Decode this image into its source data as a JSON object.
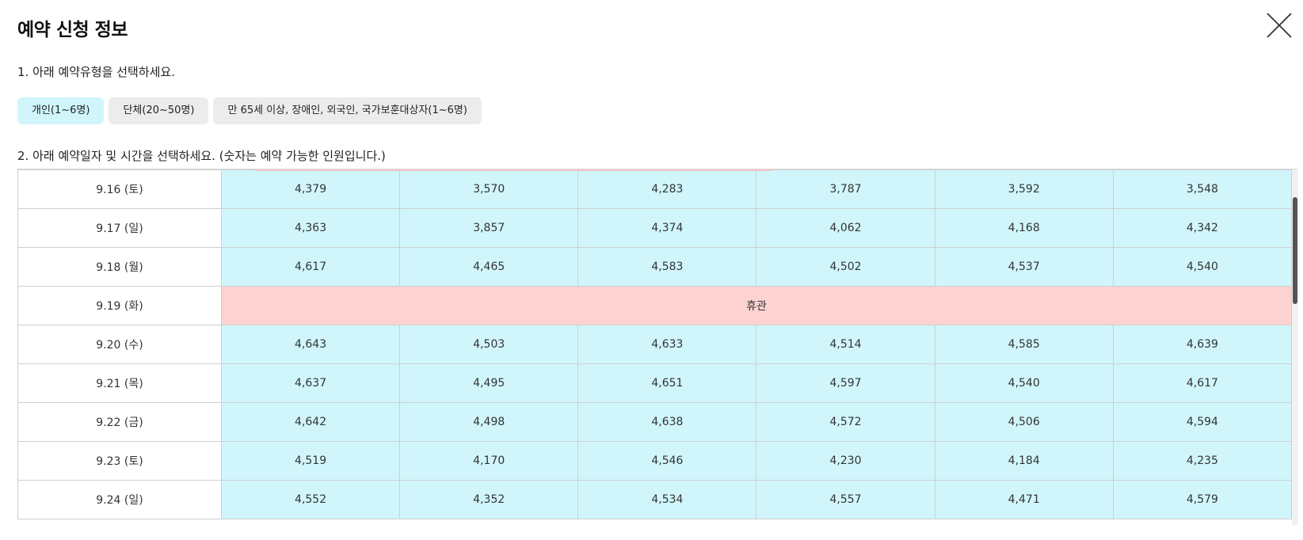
{
  "modal": {
    "title": "예약 신청 정보"
  },
  "step1": {
    "label": "1. 아래 예약유형을 선택하세요.",
    "options": [
      {
        "label": "개인(1~6명)",
        "selected": true
      },
      {
        "label": "단체(20~50명)",
        "selected": false
      },
      {
        "label": "만 65세 이상, 장애인, 외국인, 국가보훈대상자(1~6명)",
        "selected": false
      }
    ]
  },
  "step2": {
    "label": "2. 아래 예약일자 및 시간을 선택하세요. (숫자는 예약 가능한 인원입니다.)"
  },
  "schedule": {
    "rows": [
      {
        "date": "9.16 (토)",
        "slots": [
          "4,379",
          "3,570",
          "4,283",
          "3,787",
          "3,592",
          "3,548"
        ]
      },
      {
        "date": "9.17 (일)",
        "slots": [
          "4,363",
          "3,857",
          "4,374",
          "4,062",
          "4,168",
          "4,342"
        ]
      },
      {
        "date": "9.18 (월)",
        "slots": [
          "4,617",
          "4,465",
          "4,583",
          "4,502",
          "4,537",
          "4,540"
        ]
      },
      {
        "date": "9.19 (화)",
        "closed": "휴관"
      },
      {
        "date": "9.20 (수)",
        "slots": [
          "4,643",
          "4,503",
          "4,633",
          "4,514",
          "4,585",
          "4,639"
        ]
      },
      {
        "date": "9.21 (목)",
        "slots": [
          "4,637",
          "4,495",
          "4,651",
          "4,597",
          "4,540",
          "4,617"
        ]
      },
      {
        "date": "9.22 (금)",
        "slots": [
          "4,642",
          "4,498",
          "4,638",
          "4,572",
          "4,506",
          "4,594"
        ]
      },
      {
        "date": "9.23 (토)",
        "slots": [
          "4,519",
          "4,170",
          "4,546",
          "4,230",
          "4,184",
          "4,235"
        ]
      },
      {
        "date": "9.24 (일)",
        "slots": [
          "4,552",
          "4,352",
          "4,534",
          "4,557",
          "4,471",
          "4,579"
        ]
      }
    ]
  },
  "colors": {
    "selected_button": "#d0f6fc",
    "available_cell": "#d0f6fc",
    "closed_cell": "#ffd2d2"
  }
}
